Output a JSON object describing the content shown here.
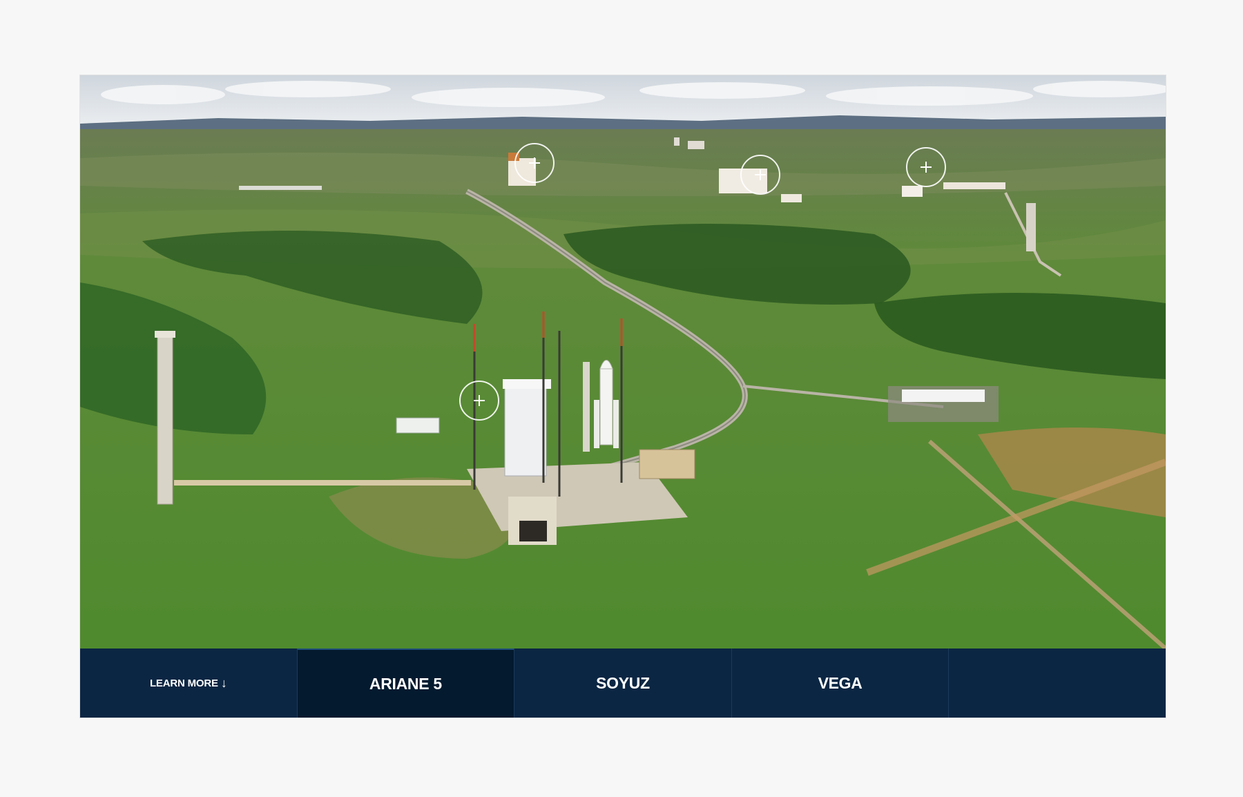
{
  "hero": {
    "image": "aerial-view-of-rocket-launch-site",
    "hotspots": [
      {
        "name": "hotspot-1",
        "icon": "plus-icon"
      },
      {
        "name": "hotspot-2",
        "icon": "plus-icon"
      },
      {
        "name": "hotspot-3",
        "icon": "plus-icon"
      },
      {
        "name": "hotspot-4",
        "icon": "plus-icon"
      }
    ]
  },
  "tabs": {
    "learn_more": "LEARN MORE",
    "learn_more_icon": "arrow-down-icon",
    "arrow": "↓",
    "items": [
      {
        "label": "ARIANE 5",
        "active": true
      },
      {
        "label": "SOYUZ",
        "active": false
      },
      {
        "label": "VEGA",
        "active": false
      }
    ]
  },
  "colors": {
    "tabbar_bg": "#0b2643",
    "active_tab_bg": "#031a2f",
    "page_bg": "#f7f7f7"
  }
}
